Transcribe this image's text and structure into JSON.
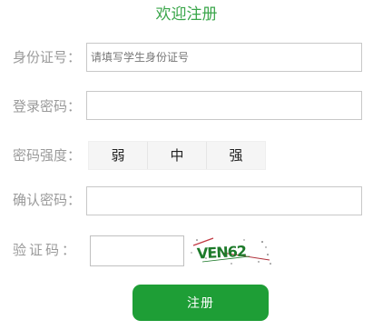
{
  "header": {
    "title": "欢迎注册"
  },
  "form": {
    "id_card": {
      "label": "身份证号：",
      "placeholder": "请填写学生身份证号",
      "value": ""
    },
    "password": {
      "label": "登录密码：",
      "value": ""
    },
    "strength": {
      "label": "密码强度：",
      "levels": [
        "弱",
        "中",
        "强"
      ]
    },
    "confirm_password": {
      "label": "确认密码：",
      "value": ""
    },
    "captcha": {
      "label": "验证码：",
      "value": "",
      "image_text": "VEN62"
    },
    "submit_label": "注册"
  },
  "colors": {
    "title": "#3aa64a",
    "label": "#9a9a9a",
    "button": "#1e9e36",
    "captcha_text": "#1d7a2a",
    "captcha_noise": "#b0303a"
  }
}
